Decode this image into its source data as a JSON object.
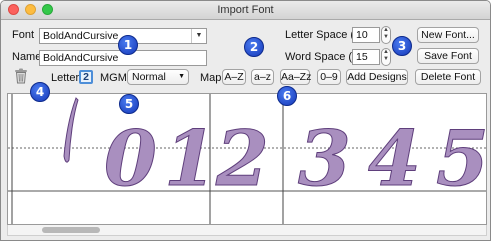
{
  "window": {
    "title": "Import Font"
  },
  "font_row": {
    "label": "Font",
    "value": "BoldAndCursive"
  },
  "name_row": {
    "label": "Name",
    "value": "BoldAndCursive"
  },
  "spacing": {
    "letter_label": "Letter Space (%)",
    "letter_value": "10",
    "word_label": "Word Space (%)",
    "word_value": "15"
  },
  "buttons": {
    "new_font": "New Font...",
    "save_font": "Save Font",
    "delete_font": "Delete Font",
    "add_designs": "Add Designs"
  },
  "letter_row": {
    "letter_label": "Letter",
    "letter_value": "2",
    "mgm_label": "MGM:",
    "mgm_value": "Normal",
    "map_label": "Map:",
    "map_buttons": [
      "A–Z",
      "a–z",
      "Aa–Zz",
      "0–9"
    ]
  },
  "badges": [
    "1",
    "2",
    "3",
    "4",
    "5",
    "6"
  ],
  "preview": {
    "glyphs": [
      "0",
      "1",
      "2",
      "3",
      "4",
      "5"
    ]
  },
  "colors": {
    "badge": "#1f46d6",
    "glyph_fill": "#a98fbf",
    "selection_border": "#4d8ed8"
  },
  "icons": {
    "trash": "trash-icon",
    "dropdown": "chevron-down-icon",
    "stepper": "stepper-arrows-icon"
  }
}
